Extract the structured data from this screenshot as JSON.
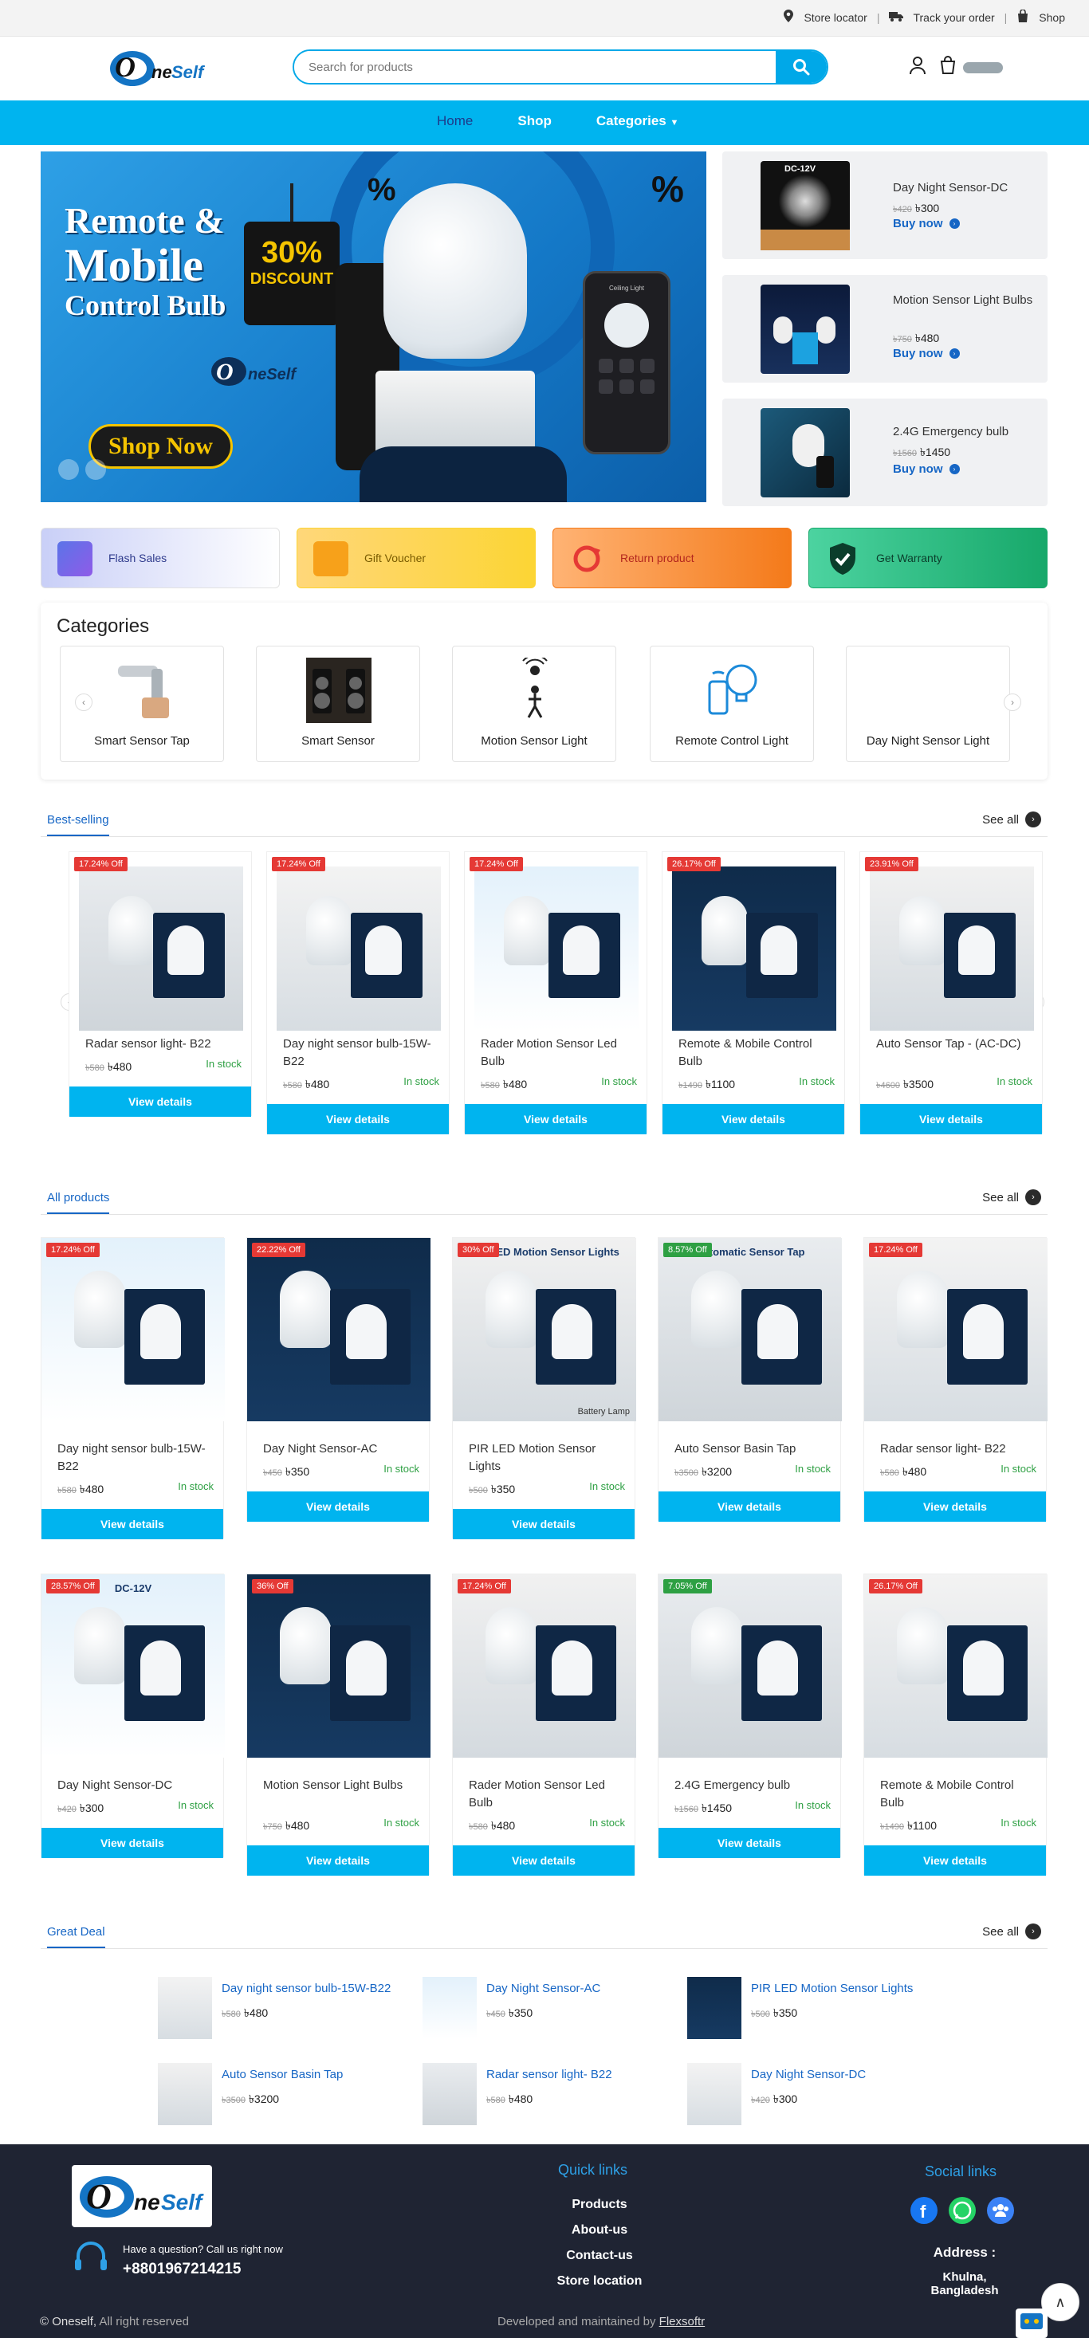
{
  "topbar": {
    "store_locator": "Store locator",
    "track_order": "Track your order",
    "shop": "Shop"
  },
  "header": {
    "brand": "OneSelf",
    "search_placeholder": "Search for products"
  },
  "nav": {
    "home": "Home",
    "shop": "Shop",
    "categories": "Categories"
  },
  "hero": {
    "line1": "Remote &",
    "line2": "Mobile",
    "line3": "Control Bulb",
    "discount_pct": "30%",
    "discount_label": "DISCOUNT",
    "shop_now": "Shop Now",
    "phone_label": "Ceiling Light"
  },
  "side_products": [
    {
      "name": "Day Night Sensor-DC",
      "old": "৳420",
      "price": "৳300",
      "buy": "Buy now",
      "img_label": "DC-12V"
    },
    {
      "name": "Motion Sensor Light Bulbs",
      "old": "৳750",
      "price": "৳480",
      "buy": "Buy now"
    },
    {
      "name": "2.4G Emergency bulb",
      "old": "৳1560",
      "price": "৳1450",
      "buy": "Buy now"
    }
  ],
  "promos": [
    "Flash Sales",
    "Gift Voucher",
    "Return product",
    "Get Warranty"
  ],
  "categories": {
    "title": "Categories",
    "items": [
      "Smart Sensor Tap",
      "Smart Sensor",
      "Motion Sensor Light",
      "Remote Control Light",
      "Day Night Sensor Light"
    ]
  },
  "best_selling": {
    "title": "Best-selling",
    "see_all": "See all",
    "view": "View details",
    "stock": "In stock",
    "items": [
      {
        "badge": "17.24% Off",
        "name": "Radar sensor light- B22",
        "old": "৳580",
        "price": "৳480"
      },
      {
        "badge": "17.24% Off",
        "name": "Day night sensor bulb-15W-B22",
        "old": "৳580",
        "price": "৳480"
      },
      {
        "badge": "17.24% Off",
        "name": "Rader Motion Sensor Led Bulb",
        "old": "৳580",
        "price": "৳480"
      },
      {
        "badge": "26.17% Off",
        "name": "Remote & Mobile Control Bulb",
        "old": "৳1490",
        "price": "৳1100"
      },
      {
        "badge": "23.91% Off",
        "name": "Auto Sensor Tap - (AC-DC)",
        "old": "৳4600",
        "price": "৳3500"
      }
    ]
  },
  "all_products": {
    "title": "All products",
    "see_all": "See all",
    "view": "View details",
    "stock": "In stock",
    "items": [
      {
        "badge": "17.24% Off",
        "name": "Day night sensor bulb-15W-B22",
        "old": "৳580",
        "price": "৳480"
      },
      {
        "badge": "22.22% Off",
        "name": "Day Night Sensor-AC",
        "old": "৳450",
        "price": "৳350"
      },
      {
        "badge": "30% Off",
        "name": "PIR LED Motion Sensor Lights",
        "old": "৳500",
        "price": "৳350",
        "img_label": "PIR LED Motion Sensor Lights",
        "img_label2": "Battery Lamp"
      },
      {
        "badge": "8.57% Off",
        "name": "Auto Sensor Basin Tap",
        "old": "৳3500",
        "price": "৳3200",
        "img_label": "Automatic Sensor Tap"
      },
      {
        "badge": "17.24% Off",
        "name": "Radar sensor light- B22",
        "old": "৳580",
        "price": "৳480"
      },
      {
        "badge": "28.57% Off",
        "name": "Day Night Sensor-DC",
        "old": "৳420",
        "price": "৳300",
        "img_label": "DC-12V"
      },
      {
        "badge": "36% Off",
        "name": "Motion Sensor Light Bulbs",
        "old": "৳750",
        "price": "৳480"
      },
      {
        "badge": "17.24% Off",
        "name": "Rader Motion Sensor Led Bulb",
        "old": "৳580",
        "price": "৳480"
      },
      {
        "badge": "7.05% Off",
        "name": "2.4G Emergency bulb",
        "old": "৳1560",
        "price": "৳1450"
      },
      {
        "badge": "26.17% Off",
        "name": "Remote & Mobile Control Bulb",
        "old": "৳1490",
        "price": "৳1100"
      }
    ]
  },
  "great_deal": {
    "title": "Great Deal",
    "see_all": "See all",
    "items": [
      {
        "name": "Day night sensor bulb-15W-B22",
        "old": "৳580",
        "price": "৳480"
      },
      {
        "name": "Day Night Sensor-AC",
        "old": "৳450",
        "price": "৳350"
      },
      {
        "name": "PIR LED Motion Sensor Lights",
        "old": "৳500",
        "price": "৳350"
      },
      {
        "name": "Auto Sensor Basin Tap",
        "old": "৳3500",
        "price": "৳3200"
      },
      {
        "name": "Radar sensor light- B22",
        "old": "৳580",
        "price": "৳480"
      },
      {
        "name": "Day Night Sensor-DC",
        "old": "৳420",
        "price": "৳300"
      }
    ]
  },
  "footer": {
    "question": "Have a question? Call us right now",
    "phone": "+8801967214215",
    "quick_links_title": "Quick links",
    "links": [
      "Products",
      "About-us",
      "Contact-us",
      "Store location"
    ],
    "social_title": "Social links",
    "address_title": "Address :",
    "address": "Khulna, Bangladesh",
    "copyright_brand": "© Oneself,",
    "copyright_rest": " All right reserved",
    "developed_by": "Developed and maintained by",
    "developer": "Flexsoftr"
  },
  "colors": {
    "accent": "#00b4ef",
    "link": "#1666c5",
    "badge_red": "#e53935",
    "badge_green": "#2ea043",
    "footer_bg": "#1f2433"
  }
}
